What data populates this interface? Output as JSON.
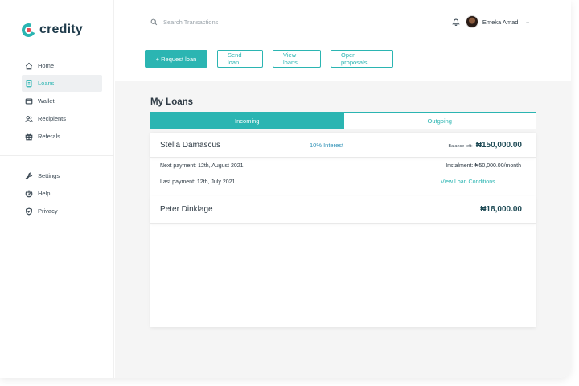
{
  "brand": {
    "name": "credity"
  },
  "sidebar": {
    "primary": [
      {
        "label": "Home",
        "icon": "home-icon",
        "active": false
      },
      {
        "label": "Loans",
        "icon": "loans-icon",
        "active": true
      },
      {
        "label": "Wallet",
        "icon": "wallet-icon",
        "active": false
      },
      {
        "label": "Recipients",
        "icon": "recipients-icon",
        "active": false
      },
      {
        "label": "Referals",
        "icon": "gift-icon",
        "active": false
      }
    ],
    "secondary": [
      {
        "label": "Settings",
        "icon": "wrench-icon"
      },
      {
        "label": "Help",
        "icon": "help-icon"
      },
      {
        "label": "Privacy",
        "icon": "shield-icon"
      }
    ]
  },
  "header": {
    "search_placeholder": "Search Transactions",
    "user_name": "Emeka Amadi"
  },
  "actions": {
    "request_loan": "+  Request loan",
    "send_loan": "Send loan",
    "view_loans": "View loans",
    "open_proposals": "Open proposals"
  },
  "page": {
    "title": "My Loans",
    "tabs": [
      {
        "label": "Incoming",
        "active": true
      },
      {
        "label": "Outgoing",
        "active": false
      }
    ]
  },
  "loans": [
    {
      "name": "Stella Damascus",
      "interest": "10% Interest",
      "balance_label": "Balance left:",
      "amount": "₦150,000.00",
      "next_payment": "Next payment: 12th, August 2021",
      "last_payment": "Last payment: 12th, July 2021",
      "instalment": "Instalment: ₦50,000.00/month",
      "conditions_link": "View Loan Conditions"
    },
    {
      "name": "Peter Dinklage",
      "amount": "₦18,000.00"
    }
  ],
  "colors": {
    "accent": "#2bb5b2",
    "dark": "#1e3a4a",
    "logo_red": "#e94b55"
  }
}
